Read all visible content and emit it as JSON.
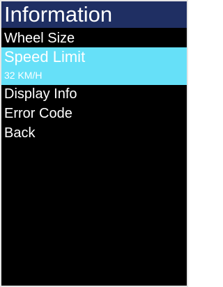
{
  "header": {
    "title": "Information"
  },
  "menu": {
    "items": [
      {
        "label": "Wheel Size"
      },
      {
        "label": "Speed Limit",
        "value": "32 KM/H",
        "selected": true
      },
      {
        "label": "Display Info"
      },
      {
        "label": "Error Code"
      },
      {
        "label": "Back"
      }
    ]
  },
  "colors": {
    "title_bar": "#1f2f63",
    "highlight": "#66e0f8",
    "background": "#000000",
    "text": "#ffffff"
  }
}
